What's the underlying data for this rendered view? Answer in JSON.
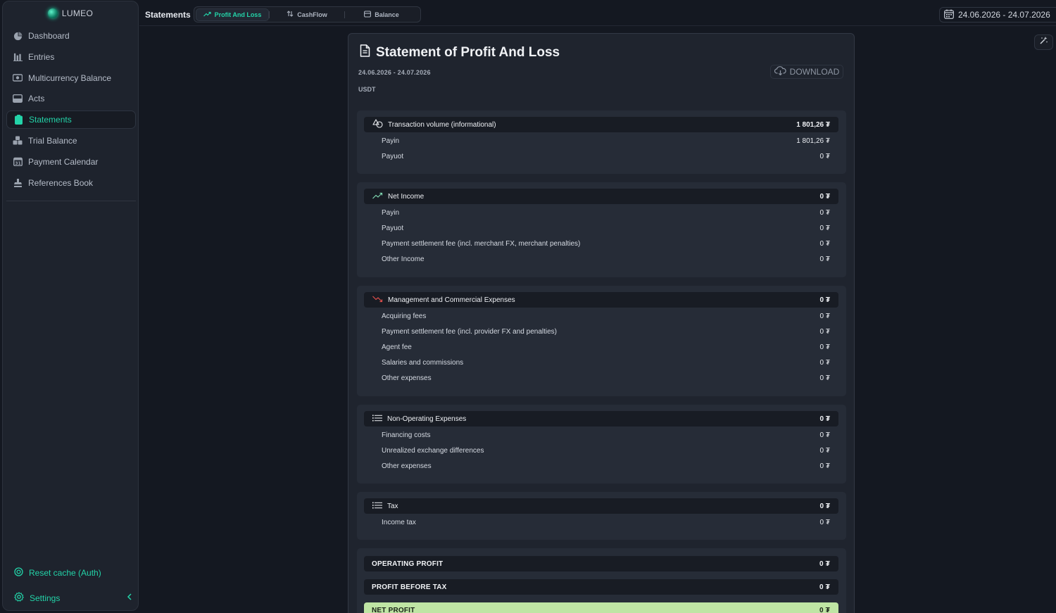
{
  "app": {
    "logo_text": "LUMEO"
  },
  "sidebar": {
    "items": [
      {
        "label": "Dashboard",
        "icon": "pie-chart-icon"
      },
      {
        "label": "Entries",
        "icon": "bar-chart-icon"
      },
      {
        "label": "Multicurrency Balance",
        "icon": "coins-icon"
      },
      {
        "label": "Acts",
        "icon": "inbox-icon"
      },
      {
        "label": "Statements",
        "icon": "clipboard-icon",
        "active": true
      },
      {
        "label": "Trial Balance",
        "icon": "cubes-icon"
      },
      {
        "label": "Payment Calendar",
        "icon": "calendar-icon"
      },
      {
        "label": "References Book",
        "icon": "stamp-icon"
      }
    ],
    "reset_cache": "Reset cache (Auth)",
    "settings": "Settings"
  },
  "header": {
    "title": "Statements",
    "tabs": [
      {
        "label": "Profit And Loss",
        "active": true
      },
      {
        "label": "CashFlow"
      },
      {
        "label": "Balance"
      }
    ],
    "date_range": "24.06.2026 - 24.07.2026"
  },
  "statement": {
    "title": "Statement of Profit And Loss",
    "period": "24.06.2026 - 24.07.2026",
    "currency": "USDT",
    "download_label": "DOWNLOAD",
    "sections": [
      {
        "title": "Transaction volume (informational)",
        "total": "1 801,26 ₮",
        "rows": [
          {
            "label": "Payin",
            "value": "1 801,26 ₮"
          },
          {
            "label": "Payuot",
            "value": "0 ₮"
          }
        ]
      },
      {
        "title": "Net Income",
        "total": "0 ₮",
        "rows": [
          {
            "label": "Payin",
            "value": "0 ₮"
          },
          {
            "label": "Payuot",
            "value": "0 ₮"
          },
          {
            "label": "Payment settlement fee (incl. merchant FX, merchant penalties)",
            "value": "0 ₮"
          },
          {
            "label": "Other Income",
            "value": "0 ₮"
          }
        ]
      },
      {
        "title": "Management and Commercial Expenses",
        "total": "0 ₮",
        "rows": [
          {
            "label": "Acquiring fees",
            "value": "0 ₮"
          },
          {
            "label": "Payment settlement fee (incl. provider FX and penalties)",
            "value": "0 ₮"
          },
          {
            "label": "Agent fee",
            "value": "0 ₮"
          },
          {
            "label": "Salaries and commissions",
            "value": "0 ₮"
          },
          {
            "label": "Other expenses",
            "value": "0 ₮"
          }
        ]
      },
      {
        "title": "Non-Operating Expenses",
        "total": "0 ₮",
        "rows": [
          {
            "label": "Financing costs",
            "value": "0 ₮"
          },
          {
            "label": "Unrealized exchange differences",
            "value": "0 ₮"
          },
          {
            "label": "Other expenses",
            "value": "0 ₮"
          }
        ]
      },
      {
        "title": "Tax",
        "total": "0 ₮",
        "rows": [
          {
            "label": "Income tax",
            "value": "0 ₮"
          }
        ]
      }
    ],
    "summary": [
      {
        "label": "OPERATING PROFIT",
        "value": "0 ₮"
      },
      {
        "label": "PROFIT BEFORE TAX",
        "value": "0 ₮"
      },
      {
        "label": "NET PROFIT",
        "value": "0 ₮"
      }
    ]
  },
  "colors": {
    "accent": "#23d3a8",
    "net_profit_bg": "#bfe5a4",
    "expense_red": "#e0504d",
    "income_green": "#7fd6b0"
  }
}
